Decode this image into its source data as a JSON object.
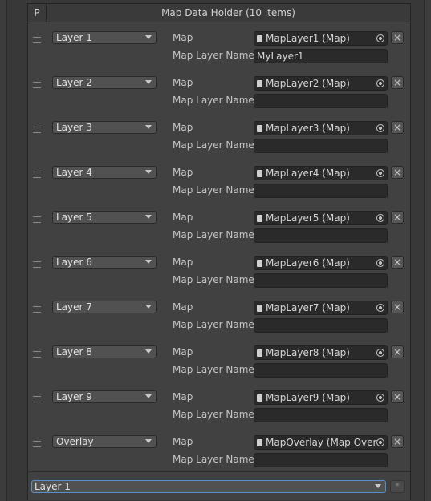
{
  "header": {
    "p_label": "P",
    "title": "Map Data Holder (10 items)"
  },
  "row_labels": {
    "map": "Map",
    "map_layer_name": "Map Layer Name"
  },
  "items": [
    {
      "layer": "Layer 1",
      "map": "MapLayer1 (Map)",
      "layer_name": "MyLayer1"
    },
    {
      "layer": "Layer 2",
      "map": "MapLayer2 (Map)",
      "layer_name": ""
    },
    {
      "layer": "Layer 3",
      "map": "MapLayer3 (Map)",
      "layer_name": ""
    },
    {
      "layer": "Layer 4",
      "map": "MapLayer4 (Map)",
      "layer_name": ""
    },
    {
      "layer": "Layer 5",
      "map": "MapLayer5 (Map)",
      "layer_name": ""
    },
    {
      "layer": "Layer 6",
      "map": "MapLayer6 (Map)",
      "layer_name": ""
    },
    {
      "layer": "Layer 7",
      "map": "MapLayer7 (Map)",
      "layer_name": ""
    },
    {
      "layer": "Layer 8",
      "map": "MapLayer8 (Map)",
      "layer_name": ""
    },
    {
      "layer": "Layer 9",
      "map": "MapLayer9 (Map)",
      "layer_name": ""
    },
    {
      "layer": "Overlay",
      "map": "MapOverlay (Map Over",
      "layer_name": ""
    }
  ],
  "icons": {
    "remove": "×",
    "add": "*"
  },
  "footer": {
    "selected_layer": "Layer 1"
  }
}
